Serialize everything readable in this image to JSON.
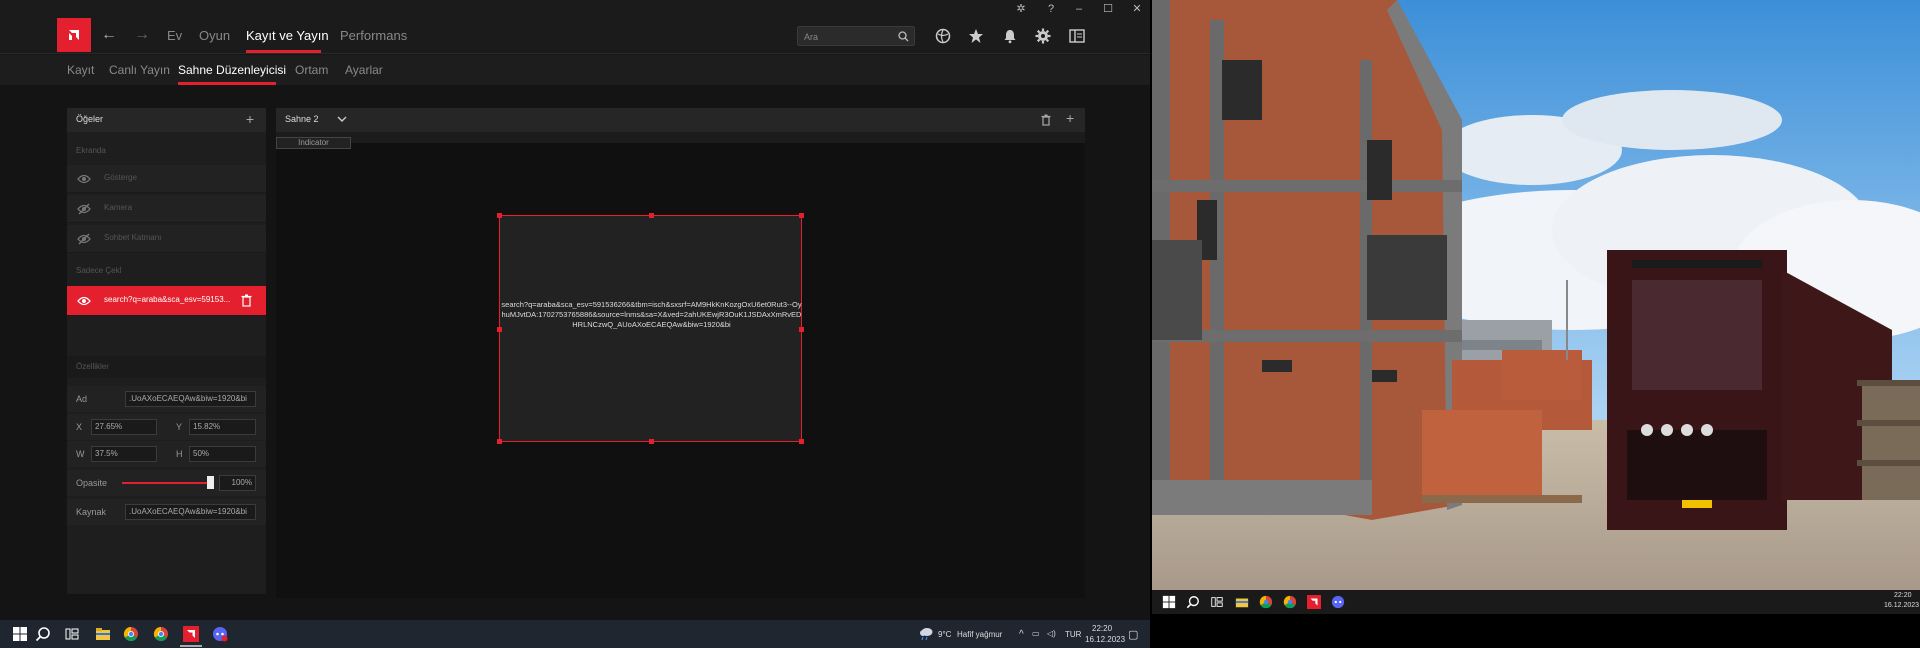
{
  "main_nav": {
    "tabs": [
      {
        "label": "Ev"
      },
      {
        "label": "Oyun"
      },
      {
        "label": "Kayıt ve Yayın"
      },
      {
        "label": "Performans"
      }
    ],
    "search_placeholder": "Ara"
  },
  "sub_nav": {
    "tabs": [
      {
        "label": "Kayıt"
      },
      {
        "label": "Canlı Yayın"
      },
      {
        "label": "Sahne Düzenleyicisi"
      },
      {
        "label": "Ortam"
      },
      {
        "label": "Ayarlar"
      }
    ]
  },
  "left_panel": {
    "title": "Öğeler",
    "section_screen": "Ekranda",
    "layers": [
      {
        "label": "Gösterge"
      },
      {
        "label": "Kamera"
      },
      {
        "label": "Sohbet Katmanı"
      }
    ],
    "section_scene_only": "Sadece Çekl",
    "selected_layer": {
      "label": "search?q=araba&sca_esv=59153..."
    },
    "properties_title": "Özellikler",
    "props": {
      "name_label": "Ad",
      "name_value": ".UoAXoECAEQAw&biw=1920&bi",
      "x_label": "X",
      "x_value": "27.65%",
      "y_label": "Y",
      "y_value": "15.82%",
      "w_label": "W",
      "w_value": "37.5%",
      "h_label": "H",
      "h_value": "50%",
      "opacity_label": "Opasite",
      "opacity_value": "100%",
      "source_label": "Kaynak",
      "source_value": ".UoAXoECAEQAw&biw=1920&bi"
    }
  },
  "center_panel": {
    "scene_name": "Sahne 2",
    "indicator_label": "Indicator",
    "source_text": "search?q=araba&sca_esv=591536266&tbm=isch&sxsrf=AM9HkKnKozgOxU6et0Rut3--OyhuMJvtDA:1702753765886&source=lnms&sa=X&ved=2ahUKEwjR3OuK1JSDAxXmRvEDHRLNCzwQ_AUoAXoECAEQAw&biw=1920&bi"
  },
  "taskbar_left": {
    "weather_temp": "9°C",
    "weather_desc": "Hafif yağmur",
    "lang": "TUR",
    "time": "22:20",
    "date": "16.12.2023"
  },
  "taskbar_right": {
    "time": "22:20",
    "date": "16.12.2023"
  },
  "colors": {
    "accent": "#e4202e",
    "background": "#151515"
  }
}
